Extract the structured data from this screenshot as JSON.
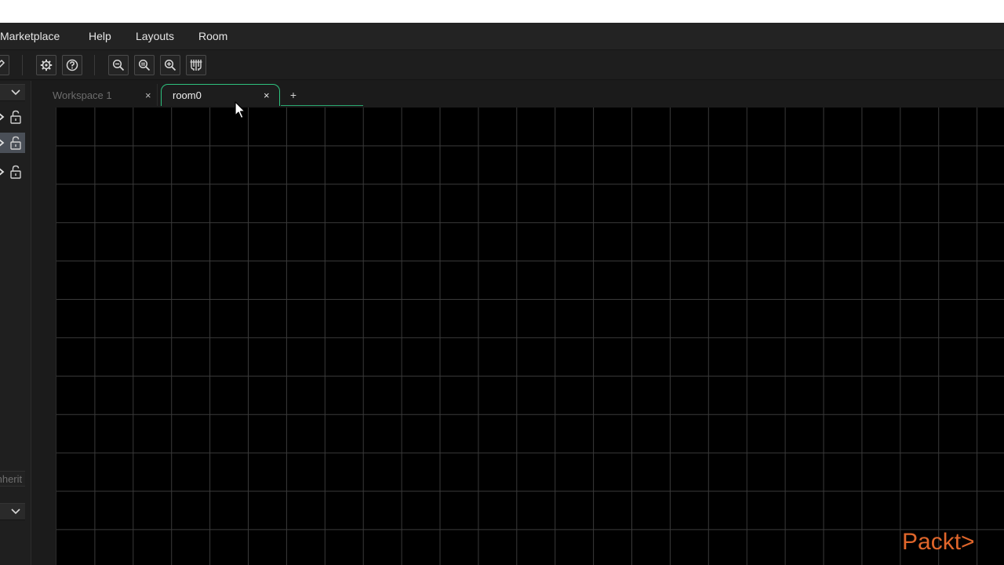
{
  "menubar": {
    "items": [
      {
        "label": "Marketplace"
      },
      {
        "label": "Help"
      },
      {
        "label": "Layouts"
      },
      {
        "label": "Room"
      }
    ]
  },
  "toolbar": {
    "buttons": [
      {
        "icon": "pencil-icon"
      },
      {
        "icon": "gear-icon"
      },
      {
        "icon": "help-icon"
      },
      {
        "icon": "zoom-out-icon"
      },
      {
        "icon": "zoom-reset-icon"
      },
      {
        "icon": "zoom-in-icon"
      },
      {
        "icon": "grid-toggle-icon"
      }
    ]
  },
  "left_panel": {
    "layers": [
      {
        "icon": "lock-icon",
        "selected": false
      },
      {
        "icon": "lock-icon",
        "selected": true
      },
      {
        "icon": "lock-icon",
        "selected": false
      }
    ],
    "inherit_label": "Inherit"
  },
  "tabs": [
    {
      "label": "Workspace 1",
      "active": false
    },
    {
      "label": "room0",
      "active": true
    }
  ],
  "add_tab_label": "+",
  "close_glyph": "×",
  "watermark": {
    "text": "Packt>"
  },
  "colors": {
    "accent": "#2ec27e",
    "canvas": "#000000",
    "grid": "#3a3a3a",
    "watermark": "#e0662b"
  }
}
